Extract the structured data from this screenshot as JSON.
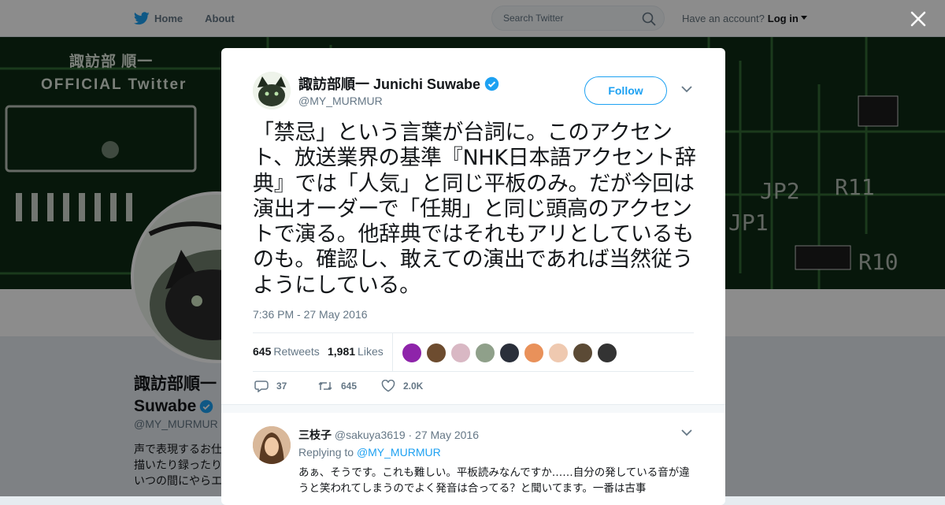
{
  "nav": {
    "home_label": "Home",
    "about_label": "About",
    "search_placeholder": "Search Twitter",
    "account_prompt": "Have an account?",
    "login_label": "Log in"
  },
  "profile": {
    "banner_line1": "諏訪部 順一",
    "banner_line2": "OFFICIAL Twitter",
    "name_line1": "諏訪部順一",
    "name_line2": "Suwabe",
    "handle": "@MY_MURMUR",
    "bio_lines": [
      "声で表現するお仕",
      "描いたり録ったり",
      "いつの間にやらエ"
    ]
  },
  "tweet": {
    "author_name": "諏訪部順一 Junichi Suwabe",
    "author_handle": "@MY_MURMUR",
    "follow_label": "Follow",
    "text": "「禁忌」という言葉が台詞に。このアクセント、放送業界の基準『NHK日本語アクセント辞典』では「人気」と同じ平板のみ。だが今回は演出オーダーで「任期」と同じ頭高のアクセントで演る。他辞典ではそれもアリとしているものも。確認し、敢えての演出であれば当然従うようにしている。",
    "timestamp": "7:36 PM - 27 May 2016",
    "retweets_count": "645",
    "retweets_label": "Retweets",
    "likes_count": "1,981",
    "likes_label": "Likes",
    "likers": [
      "#8e24aa",
      "#6d4c2f",
      "#d9b8c4",
      "#8fa08a",
      "#2a2f3a",
      "#e9915a",
      "#efc9b0",
      "#5b4a35",
      "#333333"
    ],
    "reply_count": "37",
    "retweet_action_count": "645",
    "like_action_count": "2.0K"
  },
  "reply": {
    "name": "三枝子",
    "handle": "@sakuya3619",
    "date": "· 27 May 2016",
    "replying_to_prefix": "Replying to",
    "replying_to_handle": "@MY_MURMUR",
    "text": "あぁ、そうです。これも難しい。平板読みなんですか……自分の発している音が違うと笑われてしまうのでよく発音は合ってる？と聞いてます。一番は古事"
  },
  "colors": {
    "accent": "#1da1f2",
    "banner": "#0d2412"
  }
}
